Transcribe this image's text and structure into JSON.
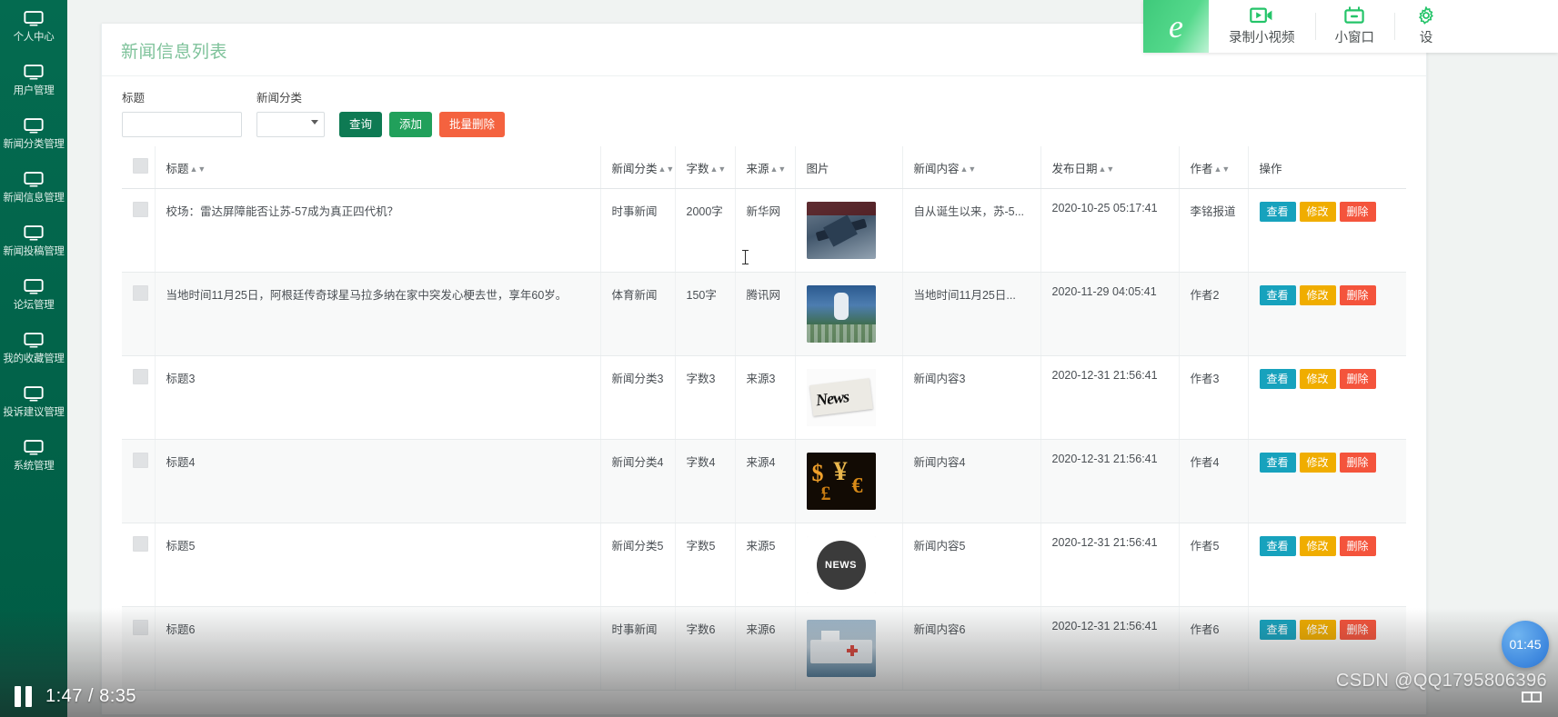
{
  "sidebar": {
    "items": [
      {
        "label": "个人中心",
        "icon": "monitor-icon"
      },
      {
        "label": "用户管理",
        "icon": "monitor-icon"
      },
      {
        "label": "新闻分类管理",
        "icon": "monitor-icon"
      },
      {
        "label": "新闻信息管理",
        "icon": "monitor-icon"
      },
      {
        "label": "新闻投稿管理",
        "icon": "monitor-icon"
      },
      {
        "label": "论坛管理",
        "icon": "monitor-icon"
      },
      {
        "label": "我的收藏管理",
        "icon": "monitor-icon"
      },
      {
        "label": "投诉建议管理",
        "icon": "monitor-icon"
      },
      {
        "label": "系统管理",
        "icon": "monitor-icon"
      }
    ]
  },
  "page": {
    "title": "新闻信息列表"
  },
  "filter": {
    "title_label": "标题",
    "title_value": "",
    "title_placeholder": "",
    "category_label": "新闻分类",
    "category_value": "",
    "btn_query": "查询",
    "btn_add": "添加",
    "btn_bulk_delete": "批量删除"
  },
  "table": {
    "headers": [
      {
        "label": "",
        "sortable": false
      },
      {
        "label": "标题",
        "sortable": true
      },
      {
        "label": "新闻分类",
        "sortable": true
      },
      {
        "label": "字数",
        "sortable": true
      },
      {
        "label": "来源",
        "sortable": true
      },
      {
        "label": "图片",
        "sortable": false
      },
      {
        "label": "新闻内容",
        "sortable": true
      },
      {
        "label": "发布日期",
        "sortable": true
      },
      {
        "label": "作者",
        "sortable": true
      },
      {
        "label": "操作",
        "sortable": false
      }
    ],
    "actions": {
      "view": "查看",
      "edit": "修改",
      "delete": "删除"
    },
    "rows": [
      {
        "title": "校场：雷达屏障能否让苏-57成为真正四代机？",
        "category": "时事新闻",
        "words": "2000字",
        "source": "新华网",
        "image": "fighter-jet-thumbnail",
        "content": "自从诞生以来，苏-5...",
        "date": "2020-10-25 05:17:41",
        "author": "李铭报道"
      },
      {
        "title": "当地时间11月25日，阿根廷传奇球星马拉多纳在家中突发心梗去世，享年60岁。",
        "category": "体育新闻",
        "words": "150字",
        "source": "腾讯网",
        "image": "stadium-crowd-thumbnail",
        "content": "当地时间11月25日...",
        "date": "2020-11-29 04:05:41",
        "author": "作者2"
      },
      {
        "title": "标题3",
        "category": "新闻分类3",
        "words": "字数3",
        "source": "来源3",
        "image": "newspaper-thumbnail",
        "content": "新闻内容3",
        "date": "2020-12-31 21:56:41",
        "author": "作者3"
      },
      {
        "title": "标题4",
        "category": "新闻分类4",
        "words": "字数4",
        "source": "来源4",
        "image": "currency-symbols-thumbnail",
        "content": "新闻内容4",
        "date": "2020-12-31 21:56:41",
        "author": "作者4"
      },
      {
        "title": "标题5",
        "category": "新闻分类5",
        "words": "字数5",
        "source": "来源5",
        "image": "news-globe-thumbnail",
        "content": "新闻内容5",
        "date": "2020-12-31 21:56:41",
        "author": "作者5"
      },
      {
        "title": "标题6",
        "category": "时事新闻",
        "words": "字数6",
        "source": "来源6",
        "image": "hospital-ship-thumbnail",
        "content": "新闻内容6",
        "date": "2020-12-31 21:56:41",
        "author": "作者6"
      }
    ]
  },
  "recorder_toolbar": {
    "logo": "e",
    "items": [
      {
        "label": "录制小视频",
        "icon": "video-camera-icon"
      },
      {
        "label": "小窗口",
        "icon": "mini-window-icon"
      },
      {
        "label": "设",
        "icon": "gear-icon"
      }
    ]
  },
  "player": {
    "state_icon": "pause-icon",
    "time": "1:47 / 8:35",
    "fullscreen_icon": "fullscreen-icon"
  },
  "overlay": {
    "timer": "01:45",
    "watermark": "CSDN @QQ1795806396"
  },
  "colors": {
    "sidebar": "#00644a",
    "title": "#7ec29a",
    "query": "#0e7a53",
    "add": "#21a05b",
    "bulk_delete": "#f4623f",
    "view": "#17a2bd",
    "edit": "#f0ad00",
    "delete": "#f4543c"
  }
}
